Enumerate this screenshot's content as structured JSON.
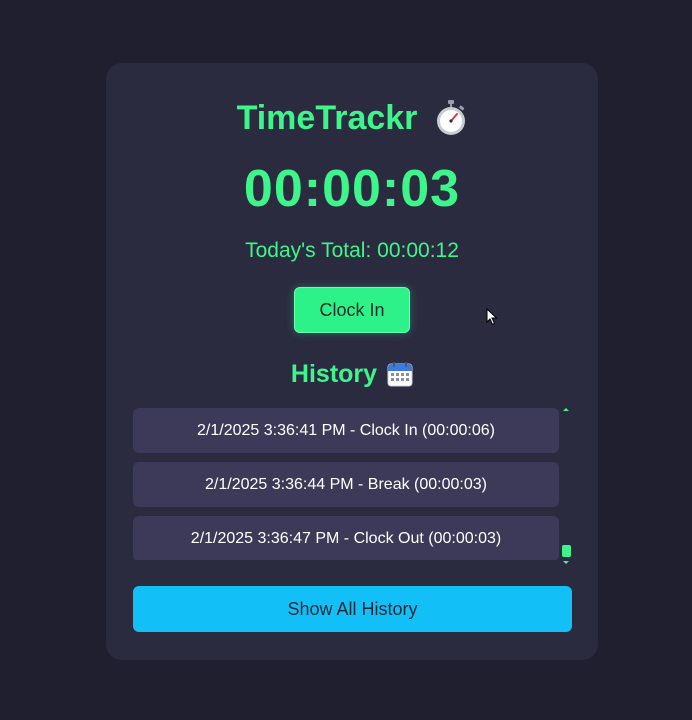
{
  "app": {
    "title": "TimeTrackr",
    "title_icon": "stopwatch-icon"
  },
  "timer": {
    "display": "00:00:03",
    "total_label": "Today's Total: 00:00:12"
  },
  "controls": {
    "clock_label": "Clock In"
  },
  "history": {
    "title": "History",
    "title_icon": "calendar-icon",
    "entries": [
      "2/1/2025 3:36:41 PM - Clock In (00:00:06)",
      "2/1/2025 3:36:44 PM - Break (00:00:03)",
      "2/1/2025 3:36:47 PM - Clock Out (00:00:03)"
    ],
    "show_all_label": "Show All History"
  },
  "colors": {
    "background": "#1f1f30",
    "card": "#2b2b40",
    "accent_green": "#3ef58b",
    "button_green": "#2df28a",
    "button_blue": "#12c0f7",
    "history_item": "#3c3a58"
  }
}
